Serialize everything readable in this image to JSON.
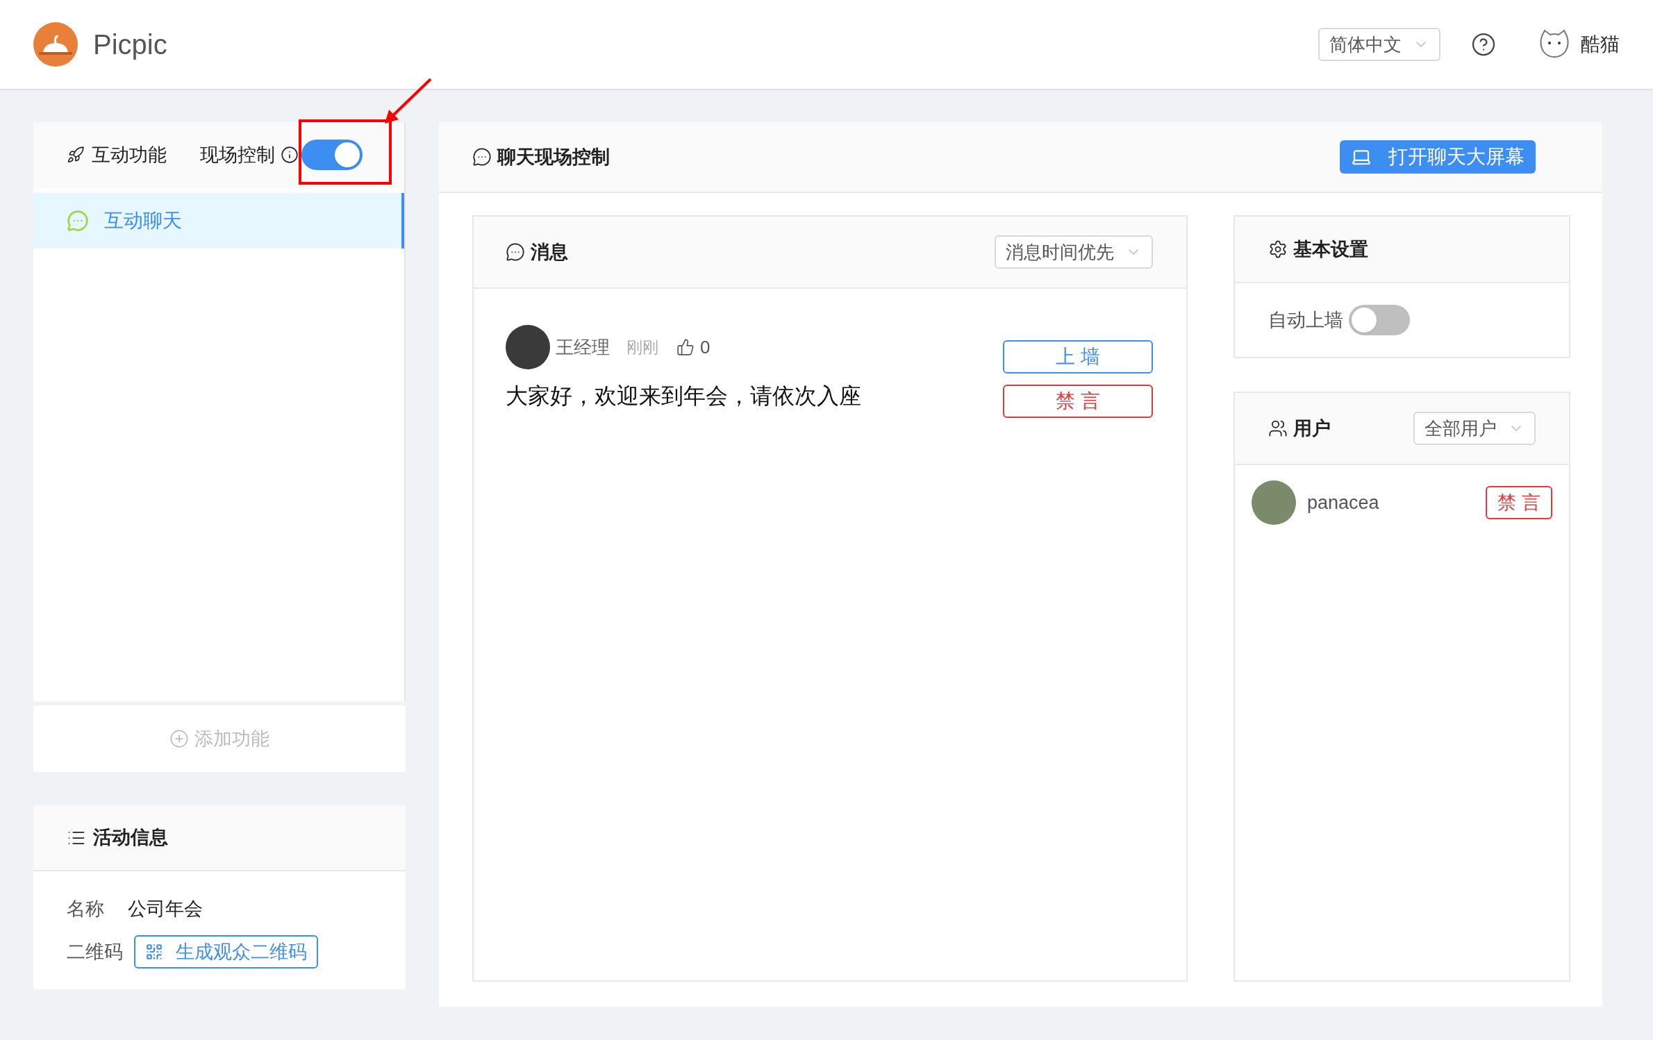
{
  "app": {
    "name": "Picpic"
  },
  "header": {
    "language": "简体中文",
    "user": "酷猫"
  },
  "sidebar": {
    "feature_tab": "互动功能",
    "live_control": {
      "label": "现场控制",
      "on": true
    },
    "items": [
      {
        "label": "互动聊天",
        "selected": true
      }
    ],
    "add_button": "添加功能"
  },
  "activity_info": {
    "title": "活动信息",
    "name_label": "名称",
    "name_value": "公司年会",
    "qr_label": "二维码",
    "qr_button": "生成观众二维码"
  },
  "chat_control": {
    "title": "聊天现场控制",
    "open_screen_button": "打开聊天大屏幕"
  },
  "messages": {
    "title": "消息",
    "sort": "消息时间优先",
    "items": [
      {
        "author": "王经理",
        "time": "刚刚",
        "likes": "0",
        "text": "大家好，欢迎来到年会，请依次入座",
        "wall_button": "上 墙",
        "mute_button": "禁 言"
      }
    ]
  },
  "settings": {
    "title": "基本设置",
    "auto_wall": {
      "label": "自动上墙",
      "on": false
    }
  },
  "users": {
    "title": "用户",
    "filter": "全部用户",
    "items": [
      {
        "name": "panacea",
        "mute_button": "禁 言"
      }
    ]
  }
}
